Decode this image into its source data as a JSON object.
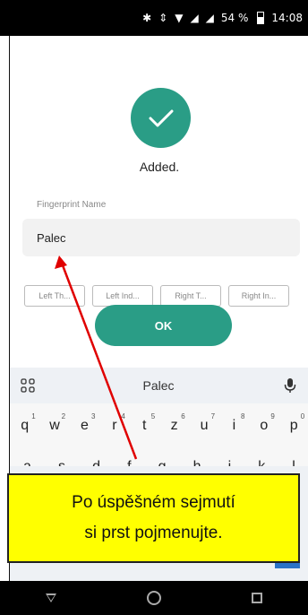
{
  "status_bar": {
    "bluetooth_icon": "bluetooth-icon",
    "vibrate_icon": "vibrate-icon",
    "wifi_icon": "wifi-icon",
    "signal_icon_1": "signal-icon",
    "signal_icon_2": "signal-icon",
    "battery_text": "54 %",
    "time": "14:08"
  },
  "success": {
    "message": "Added."
  },
  "form": {
    "label": "Fingerprint Name",
    "value": "Palec",
    "chips": [
      "Left Th...",
      "Left Ind...",
      "Right T...",
      "Right In..."
    ],
    "ok_label": "OK"
  },
  "keyboard": {
    "suggestion": "Palec",
    "row1": [
      {
        "k": "q",
        "n": "1"
      },
      {
        "k": "w",
        "n": "2"
      },
      {
        "k": "e",
        "n": "3"
      },
      {
        "k": "r",
        "n": "4"
      },
      {
        "k": "t",
        "n": "5"
      },
      {
        "k": "z",
        "n": "6"
      },
      {
        "k": "u",
        "n": "7"
      },
      {
        "k": "i",
        "n": "8"
      },
      {
        "k": "o",
        "n": "9"
      },
      {
        "k": "p",
        "n": "0"
      }
    ],
    "row2": [
      "a",
      "s",
      "d",
      "f",
      "g",
      "h",
      "j",
      "k",
      "l"
    ]
  },
  "callout": {
    "line1": "Po úspěšném sejmutí",
    "line2": "si prst pojmenujte."
  },
  "colors": {
    "accent": "#2a9d86",
    "callout_bg": "#ffff00",
    "arrow": "#e00000"
  }
}
